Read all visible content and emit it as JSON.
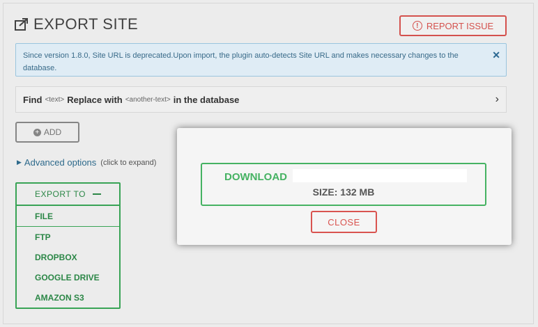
{
  "header": {
    "title": "EXPORT SITE",
    "report_label": "REPORT ISSUE"
  },
  "notice": {
    "text": "Since version 1.8.0, Site URL is deprecated.Upon import, the plugin auto-detects Site URL and makes necessary changes to the database.",
    "close_glyph": "✕"
  },
  "find_replace": {
    "find_label": "Find",
    "find_placeholder": "<text>",
    "replace_label": "Replace with",
    "replace_placeholder": "<another-text>",
    "suffix": "in the database"
  },
  "add_button": {
    "label": "ADD"
  },
  "advanced": {
    "label": "Advanced options",
    "hint": "(click to expand)"
  },
  "export_to": {
    "title": "EXPORT TO",
    "items": [
      "FILE",
      "FTP",
      "DROPBOX",
      "GOOGLE DRIVE",
      "AMAZON S3"
    ]
  },
  "modal": {
    "download_label": "DOWNLOAD",
    "size_text": "SIZE: 132 MB",
    "close_label": "CLOSE"
  },
  "colors": {
    "green": "#3aa757",
    "red": "#d9534f",
    "blue_link": "#2e6c8e"
  }
}
